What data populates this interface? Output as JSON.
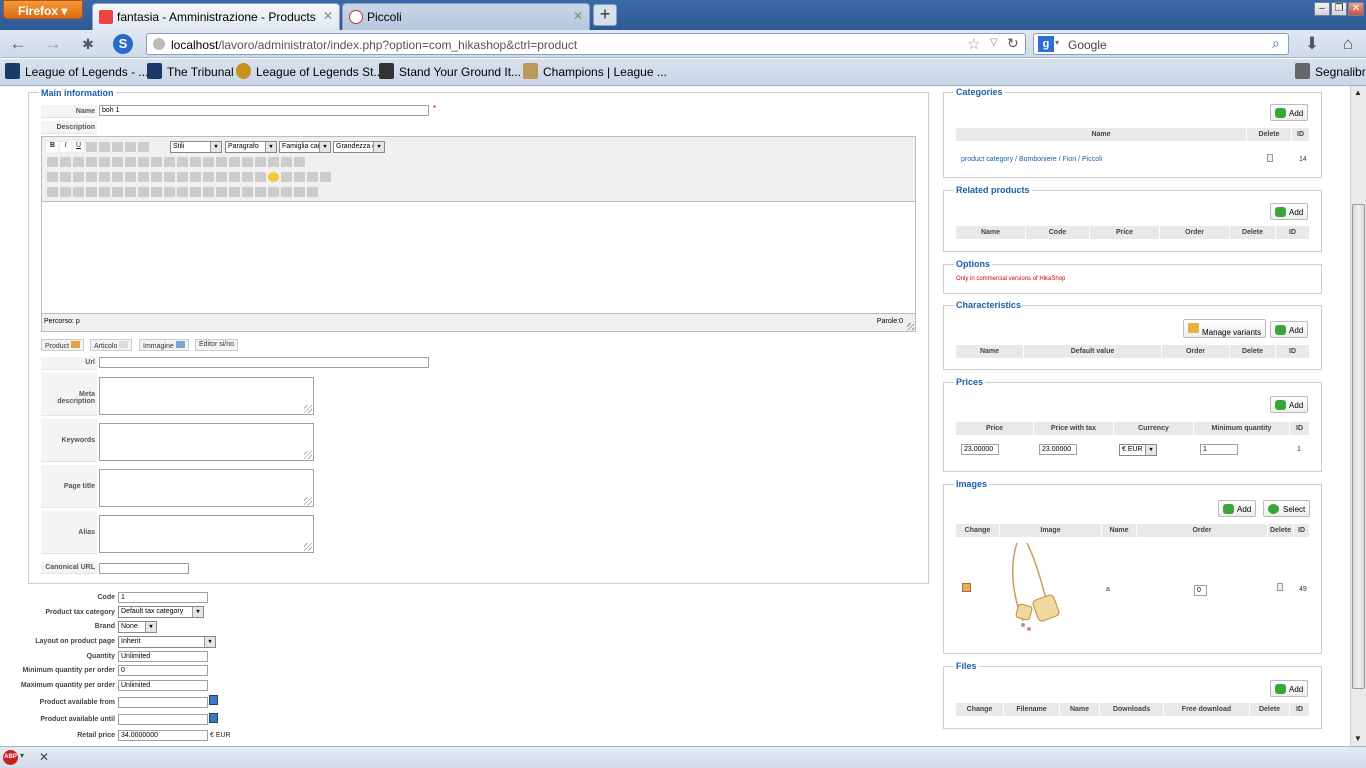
{
  "browser": {
    "app_button": "Firefox",
    "tabs": [
      {
        "label": "fantasia - Amministrazione - Products"
      },
      {
        "label": "Piccoli"
      }
    ],
    "url_host": "localhost",
    "url_path": "/lavoro/administrator/index.php?option=com_hikashop&ctrl=product",
    "search_placeholder": "Google",
    "bookmarks": [
      {
        "label": "League of Legends - ..."
      },
      {
        "label": "The Tribunal"
      },
      {
        "label": "League of Legends St..."
      },
      {
        "label": "Stand Your Ground It..."
      },
      {
        "label": "Champions | League ..."
      }
    ],
    "bookmarks_menu": "Segnalibri",
    "status_addon": "ABP"
  },
  "main": {
    "legend": "Main information",
    "name_label": "Name",
    "name_value": "boh 1",
    "required_mark": "*",
    "description_label": "Description",
    "editor": {
      "style_select": "Stili",
      "paragraph_select": "Paragrafo",
      "font_family_select": "Famiglia car.",
      "font_size_select": "Grandezza ca",
      "path_label": "Percorso: p",
      "words_label": "Parole:0"
    },
    "editor_buttons": [
      "Product",
      "Articolo",
      "Immagine",
      "Editor si/no"
    ],
    "url_label": "Url",
    "meta_description_label": "Meta description",
    "keywords_label": "Keywords",
    "page_title_label": "Page title",
    "alias_label": "Alias",
    "canonical_label": "Canonical URL"
  },
  "product_fields": {
    "code_label": "Code",
    "code_value": "1",
    "tax_label": "Product tax category",
    "tax_value": "Default tax category",
    "brand_label": "Brand",
    "brand_value": "None",
    "layout_label": "Layout on product page",
    "layout_value": "Inherit",
    "quantity_label": "Quantity",
    "quantity_value": "Unlimited",
    "min_qty_label": "Minimum quantity per order",
    "min_qty_value": "0",
    "max_qty_label": "Maximum quantity per order",
    "max_qty_value": "Unlimited",
    "avail_from_label": "Product available from",
    "avail_until_label": "Product available until",
    "retail_label": "Retail price",
    "retail_value": "34.0000000",
    "retail_currency": "€ EUR"
  },
  "categories": {
    "legend": "Categories",
    "add": "Add",
    "headers": [
      "Name",
      "Delete",
      "ID"
    ],
    "row": {
      "name": "product category / Bomboniere / Fiori / Piccoli",
      "id": "14"
    }
  },
  "related": {
    "legend": "Related products",
    "add": "Add",
    "headers": [
      "Name",
      "Code",
      "Price",
      "Order",
      "Delete",
      "ID"
    ]
  },
  "options": {
    "legend": "Options",
    "note": "Only in commercial versions of HikaShop"
  },
  "characteristics": {
    "legend": "Characteristics",
    "manage": "Manage variants",
    "add": "Add",
    "headers": [
      "Name",
      "Default value",
      "Order",
      "Delete",
      "ID"
    ]
  },
  "prices": {
    "legend": "Prices",
    "add": "Add",
    "headers": [
      "Price",
      "Price with tax",
      "Currency",
      "Minimum quantity",
      "ID"
    ],
    "row": {
      "price": "23.00000",
      "price_tax": "23.00000",
      "currency": "€ EUR",
      "min_qty": "1",
      "id": "1"
    }
  },
  "images": {
    "legend": "Images",
    "add": "Add",
    "select": "Select",
    "headers": [
      "Change",
      "Image",
      "Name",
      "Order",
      "Delete",
      "ID"
    ],
    "row": {
      "name": "a",
      "order": "0",
      "id": "49"
    }
  },
  "files": {
    "legend": "Files",
    "add": "Add",
    "headers": [
      "Change",
      "Filename",
      "Name",
      "Downloads",
      "Free download",
      "Delete",
      "ID"
    ]
  }
}
